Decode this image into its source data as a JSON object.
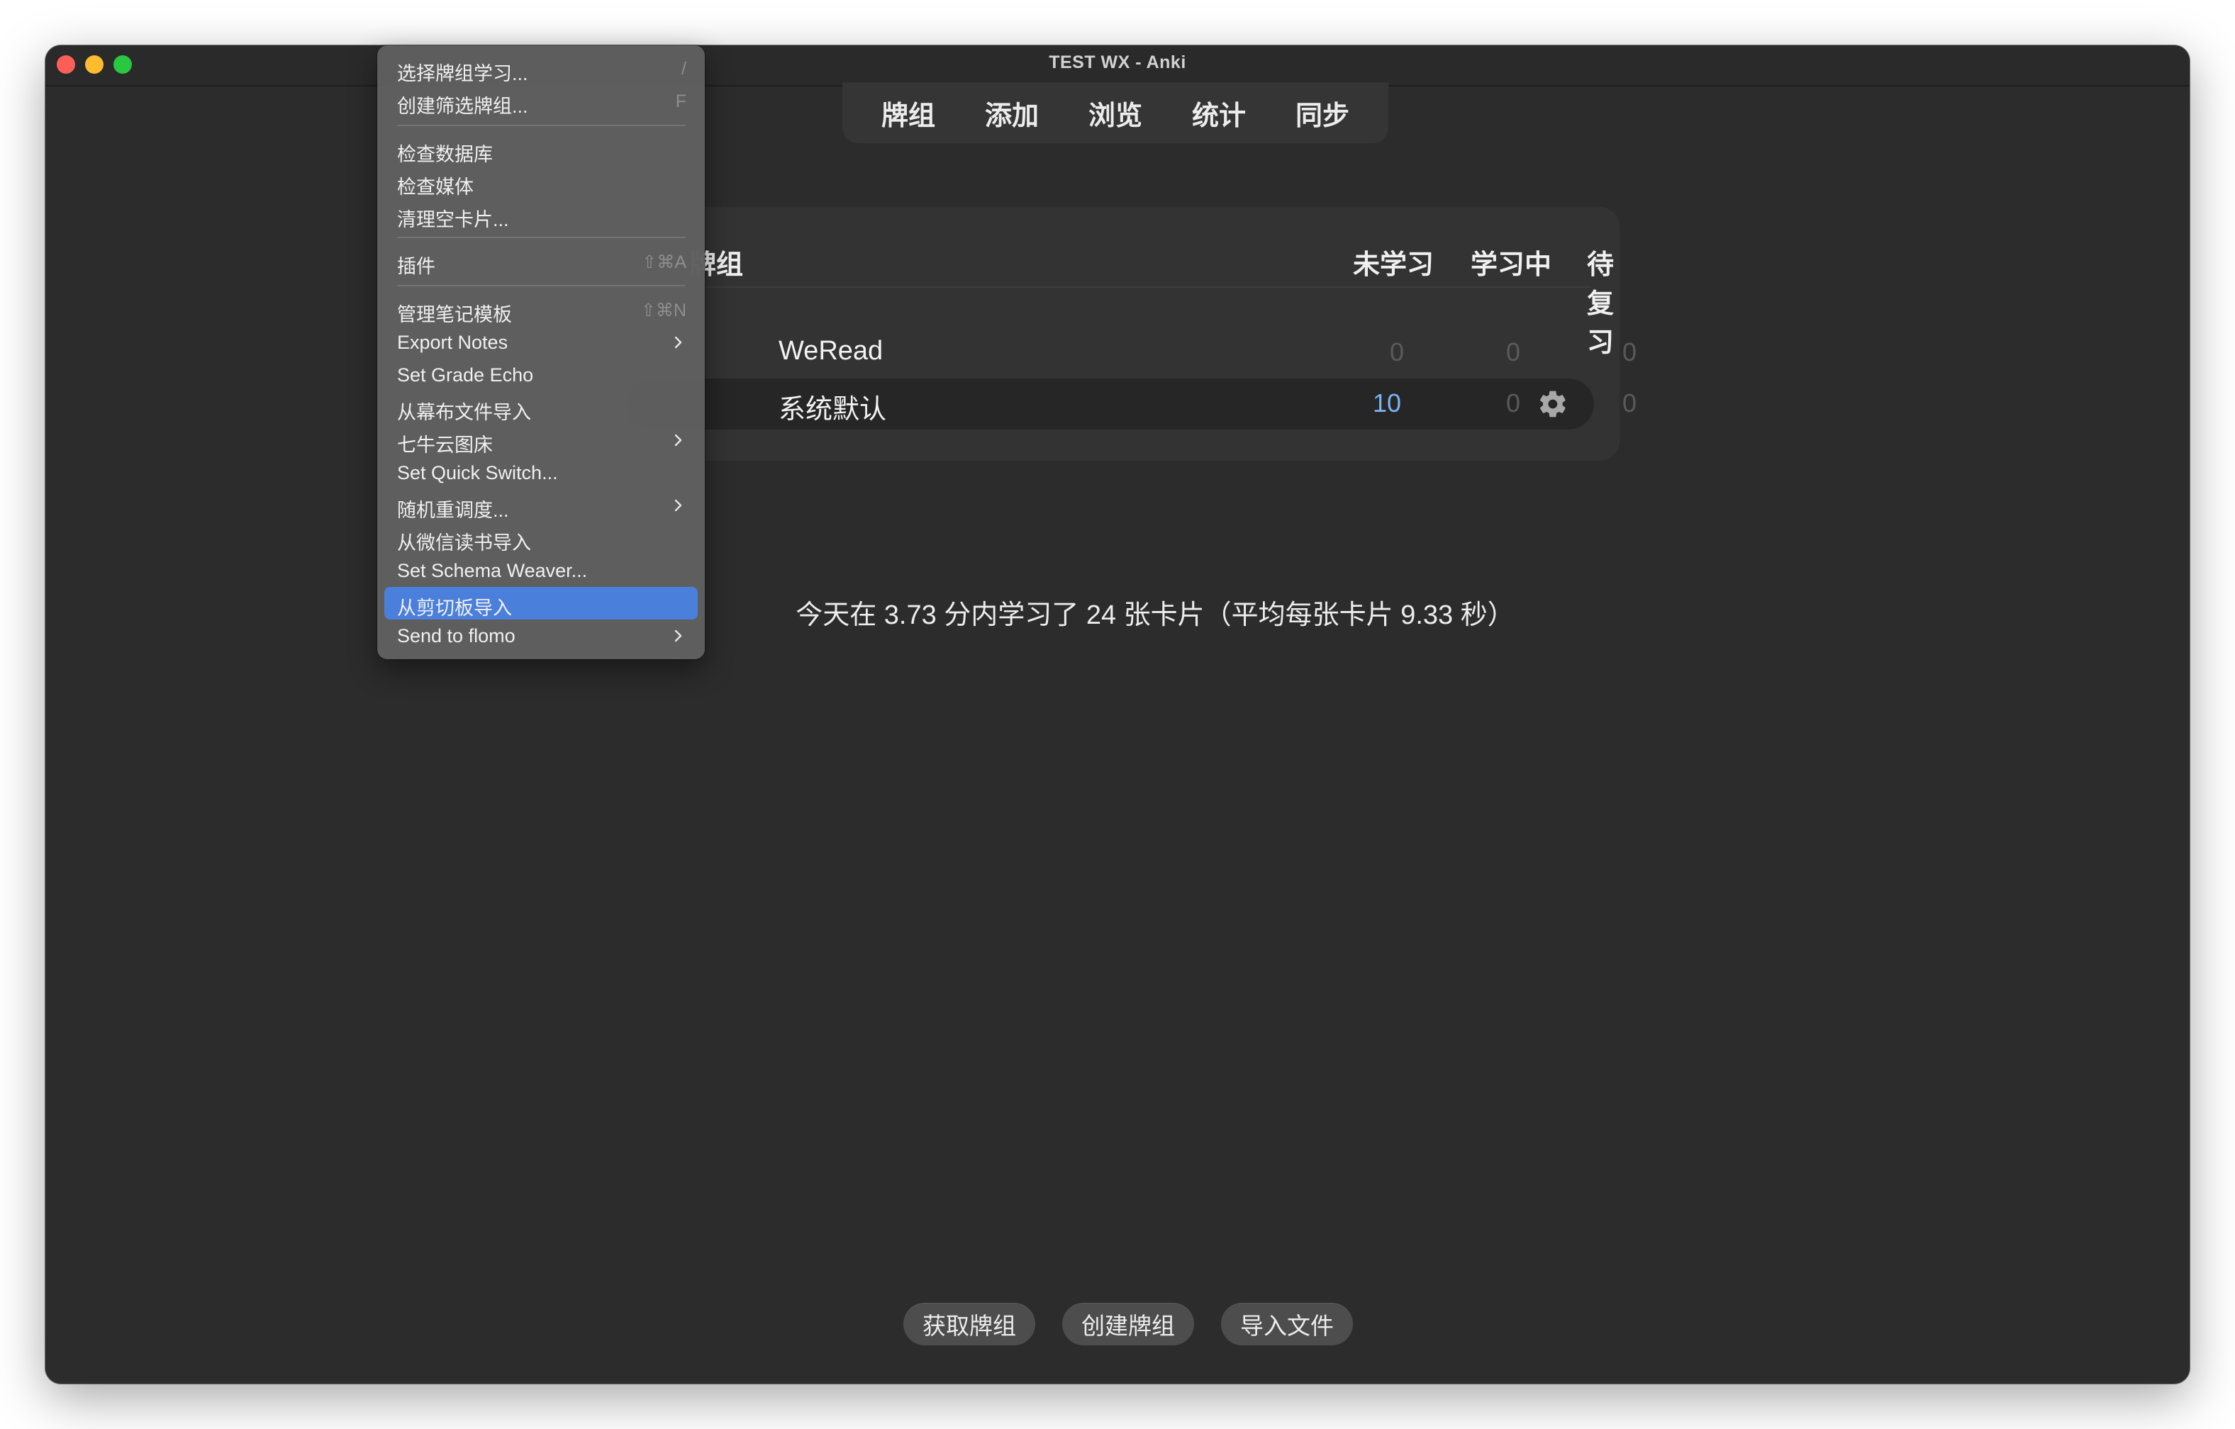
{
  "window": {
    "title": "TEST WX - Anki"
  },
  "toolbar": {
    "items": [
      "牌组",
      "添加",
      "浏览",
      "统计",
      "同步"
    ]
  },
  "deck_table": {
    "headers": {
      "deck": "牌组",
      "new": "未学习",
      "learning": "学习中",
      "due": "待复习"
    },
    "rows": [
      {
        "name": "WeRead",
        "new": "0",
        "learning": "0",
        "due": "0"
      },
      {
        "name": "系统默认",
        "new": "10",
        "learning": "0",
        "due": "0"
      }
    ]
  },
  "stats": {
    "text": "今天在 3.73 分内学习了 24 张卡片（平均每张卡片 9.33 秒）"
  },
  "bottom_buttons": [
    "获取牌组",
    "创建牌组",
    "导入文件"
  ],
  "menu": {
    "items": [
      {
        "label": "选择牌组学习...",
        "shortcut": "/"
      },
      {
        "label": "创建筛选牌组...",
        "shortcut": "F"
      },
      {
        "label": "检查数据库",
        "shortcut": ""
      },
      {
        "label": "检查媒体",
        "shortcut": ""
      },
      {
        "label": "清理空卡片...",
        "shortcut": ""
      },
      {
        "label": "插件",
        "shortcut": "⇧⌘A"
      },
      {
        "label": "管理笔记模板",
        "shortcut": "⇧⌘N"
      },
      {
        "label": "Export Notes",
        "shortcut": ""
      },
      {
        "label": "Set Grade Echo",
        "shortcut": ""
      },
      {
        "label": "从幕布文件导入",
        "shortcut": ""
      },
      {
        "label": "七牛云图床",
        "shortcut": ""
      },
      {
        "label": "Set Quick Switch...",
        "shortcut": ""
      },
      {
        "label": "随机重调度...",
        "shortcut": ""
      },
      {
        "label": "从微信读书导入",
        "shortcut": ""
      },
      {
        "label": "Set Schema Weaver...",
        "shortcut": ""
      },
      {
        "label": "从剪切板导入",
        "shortcut": ""
      },
      {
        "label": "Send to flomo",
        "shortcut": ""
      }
    ],
    "highlighted_item": "从剪切板导入"
  },
  "colors": {
    "accent_highlight": "#4b7fdc",
    "new_count": "#7ab4f2",
    "window_bg": "#2c2c2c"
  }
}
